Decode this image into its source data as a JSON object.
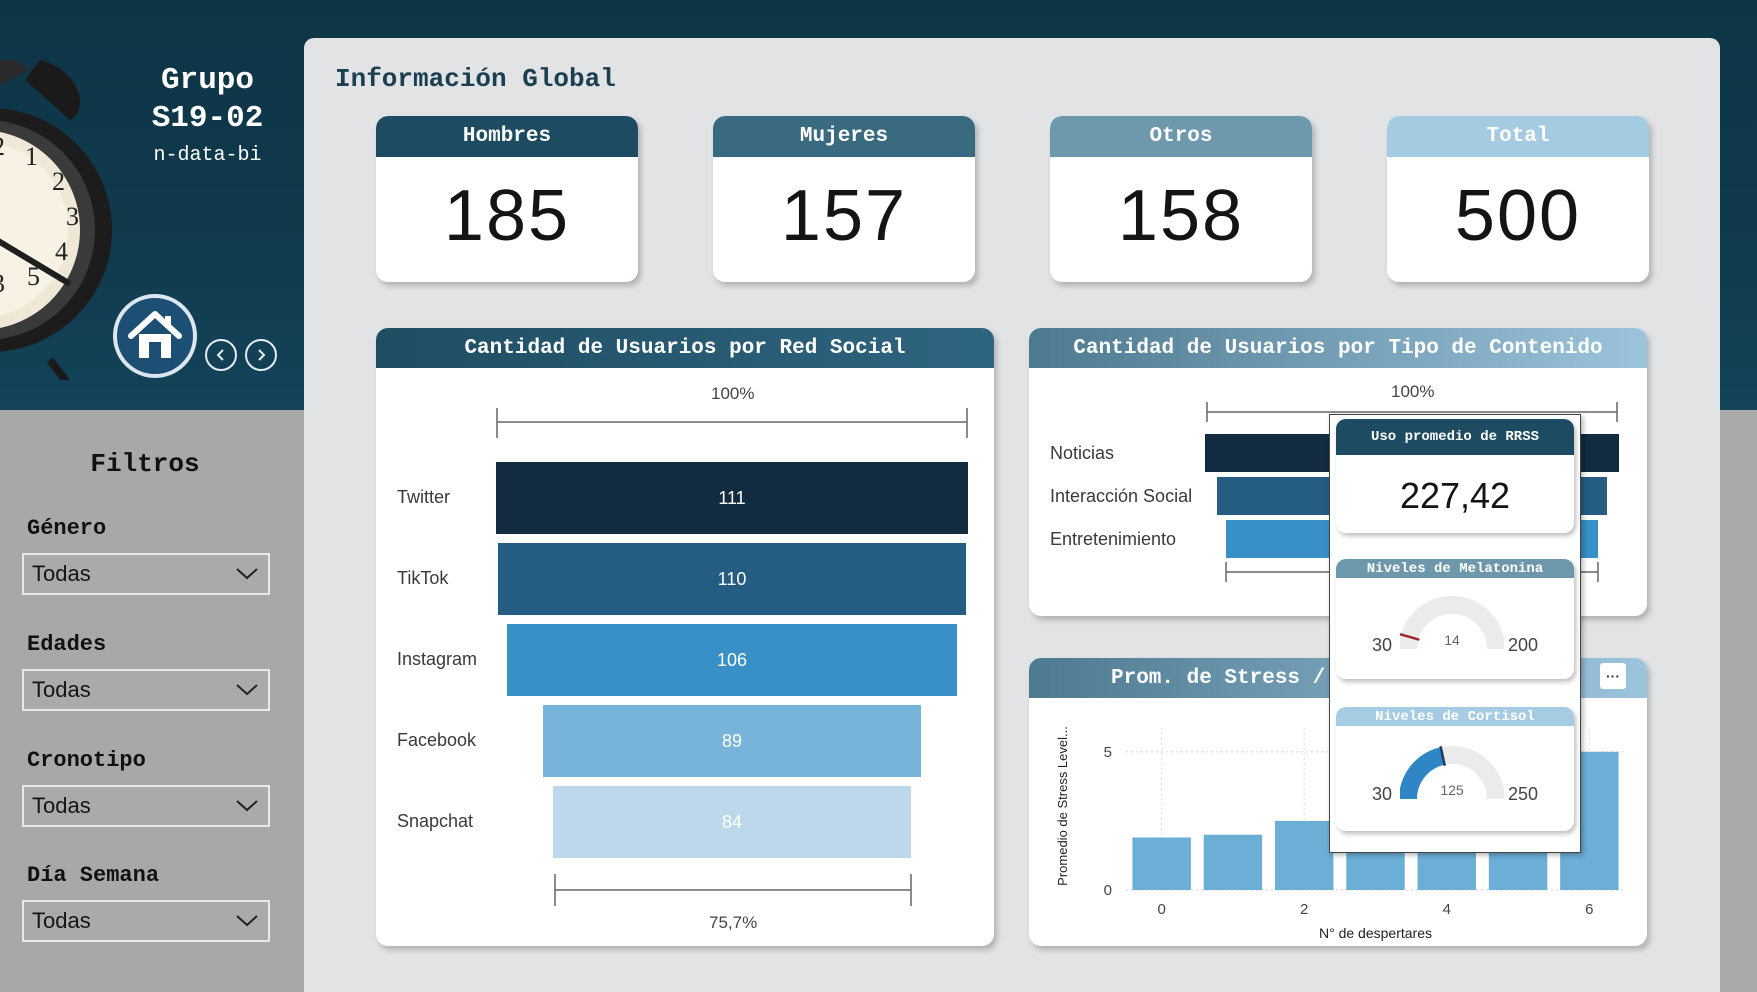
{
  "header": {
    "title_line1": "Grupo",
    "title_line2": "S19-02",
    "subtitle": "n-data-bi",
    "clock_numbers": [
      "2",
      "1",
      "2",
      "3",
      "4",
      "5",
      "3"
    ]
  },
  "filters": {
    "title": "Filtros",
    "items": [
      {
        "label": "Género",
        "value": "Todas"
      },
      {
        "label": "Edades",
        "value": "Todas"
      },
      {
        "label": "Cronotipo",
        "value": "Todas"
      },
      {
        "label": "Día Semana",
        "value": "Todas"
      }
    ]
  },
  "main": {
    "title": "Información Global"
  },
  "kpis": [
    {
      "label": "Hombres",
      "value": "185",
      "color": "#1d4c62"
    },
    {
      "label": "Mujeres",
      "value": "157",
      "color": "#3a6a80"
    },
    {
      "label": "Otros",
      "value": "158",
      "color": "#6e99ad"
    },
    {
      "label": "Total",
      "value": "500",
      "color": "#a5cbe2"
    }
  ],
  "social_funnel": {
    "title": "Cantidad de Usuarios por Red Social",
    "top_pct": "100%",
    "bottom_pct": "75,7%",
    "items": [
      {
        "label": "Twitter",
        "value": 111,
        "color": "#132b40",
        "text_color": "#ffffff"
      },
      {
        "label": "TikTok",
        "value": 110,
        "color": "#245d81",
        "text_color": "#ffffff"
      },
      {
        "label": "Instagram",
        "value": 106,
        "color": "#3890c6",
        "text_color": "#ffffff"
      },
      {
        "label": "Facebook",
        "value": 89,
        "color": "#78b4d9",
        "text_color": "#ffffff"
      },
      {
        "label": "Snapchat",
        "value": 84,
        "color": "#bed8eb",
        "text_color": "#ffffff"
      }
    ]
  },
  "content_funnel": {
    "title": "Cantidad de Usuarios por Tipo de Contenido",
    "top_pct": "100%",
    "items": [
      {
        "label": "Noticias",
        "value": 100,
        "color": "#132b40"
      },
      {
        "label": "Interacción Social",
        "value": 94,
        "color": "#245d81"
      },
      {
        "label": "Entretenimiento",
        "value": 90,
        "color": "#3890c6"
      }
    ]
  },
  "stress_chart": {
    "title": "Prom. de Stress /",
    "more_label": "···"
  },
  "tooltip": {
    "uso_title": "Uso promedio de RRSS",
    "uso_value": "227,42",
    "melatonina": {
      "title": "Niveles de Melatonina",
      "min": "30",
      "max": "200",
      "value": "14",
      "val": 14,
      "lo": 30,
      "hi": 200
    },
    "cortisol": {
      "title": "Niveles de Cortisol",
      "min": "30",
      "max": "250",
      "value": "125",
      "val": 125,
      "lo": 30,
      "hi": 250
    }
  },
  "chart_data": {
    "type": "bar",
    "title": "",
    "xlabel": "N° de despertares",
    "ylabel": "Promedio de Stress Level...",
    "x": [
      0,
      1,
      2,
      3,
      4,
      5,
      6
    ],
    "values": [
      1.9,
      2.0,
      2.5,
      3.4,
      3.7,
      4.4,
      5.0
    ],
    "xticks": [
      "0",
      "2",
      "4",
      "6"
    ],
    "yticks": [
      "0",
      "5"
    ],
    "ylim": [
      0,
      5.5
    ],
    "grid": true,
    "color": "#6baed6"
  }
}
